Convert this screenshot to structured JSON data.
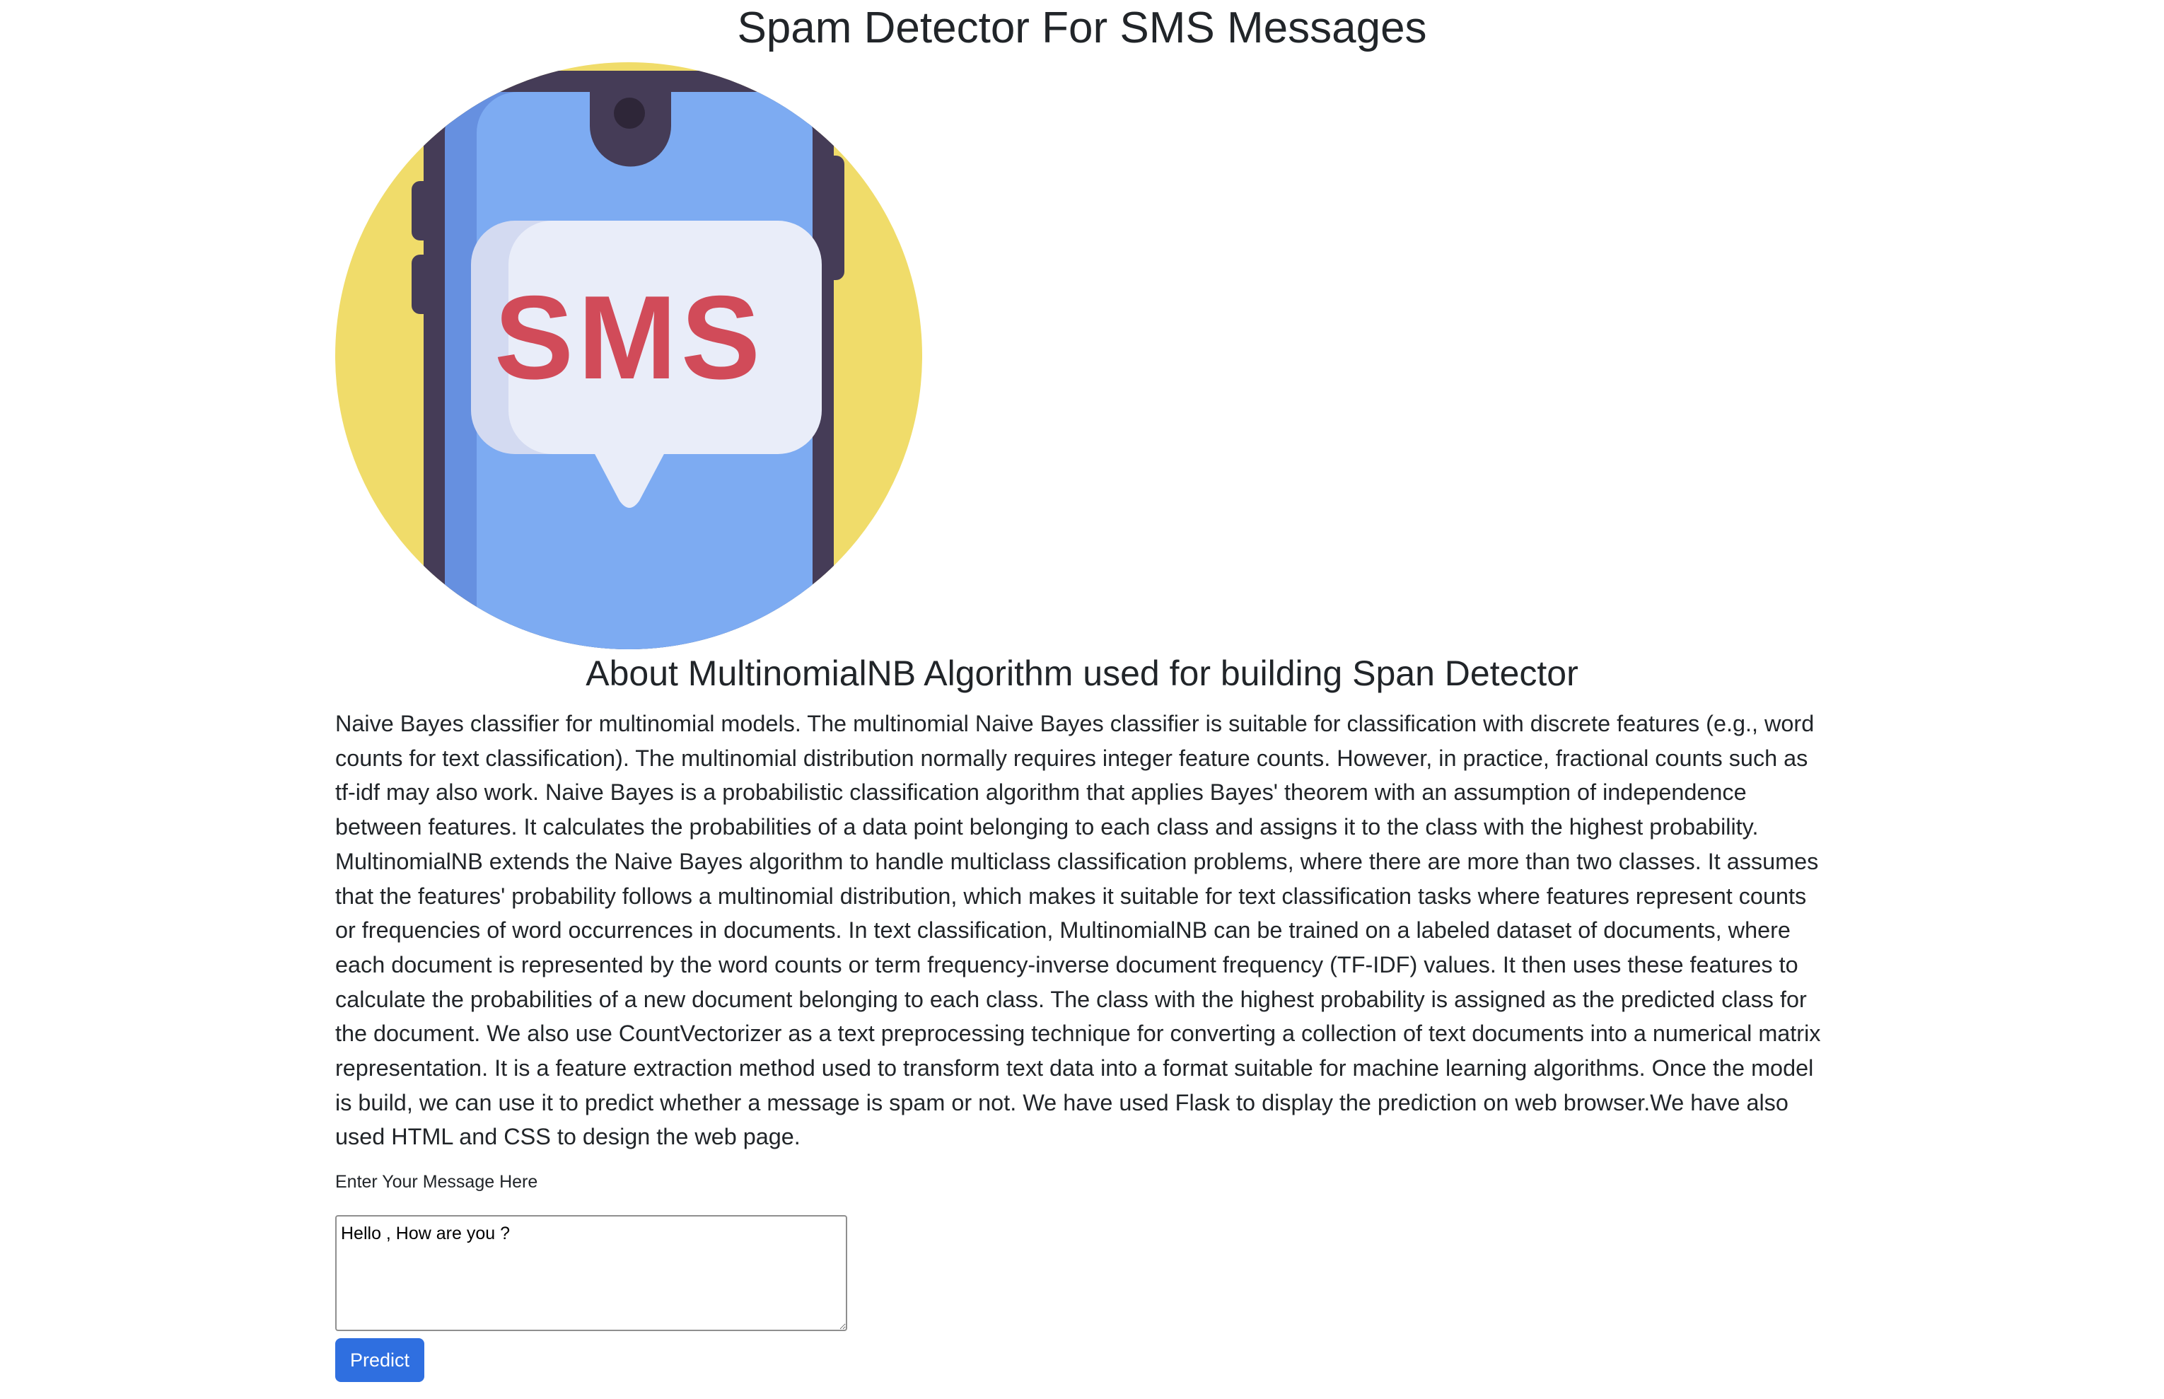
{
  "page": {
    "title": "Spam Detector For SMS Messages"
  },
  "hero": {
    "icon_name": "sms-phone-icon",
    "sms_text": "SMS",
    "colors": {
      "circle": "#f0dc6a",
      "phone_frame": "#453c57",
      "screen": "#7dabf2",
      "screen_shadow": "#6690e0",
      "bubble": "#e9edf9",
      "bubble_shadow": "#d3daf1",
      "sms_text": "#d14b59"
    }
  },
  "about": {
    "heading": "About MultinomialNB Algorithm used for building Span Detector",
    "text": "Naive Bayes classifier for multinomial models. The multinomial Naive Bayes classifier is suitable for classification with discrete features (e.g., word counts for text classification). The multinomial distribution normally requires integer feature counts. However, in practice, fractional counts such as tf-idf may also work. Naive Bayes is a probabilistic classification algorithm that applies Bayes' theorem with an assumption of independence between features. It calculates the probabilities of a data point belonging to each class and assigns it to the class with the highest probability. MultinomialNB extends the Naive Bayes algorithm to handle multiclass classification problems, where there are more than two classes. It assumes that the features' probability follows a multinomial distribution, which makes it suitable for text classification tasks where features represent counts or frequencies of word occurrences in documents. In text classification, MultinomialNB can be trained on a labeled dataset of documents, where each document is represented by the word counts or term frequency-inverse document frequency (TF-IDF) values. It then uses these features to calculate the probabilities of a new document belonging to each class. The class with the highest probability is assigned as the predicted class for the document. We also use CountVectorizer as a text preprocessing technique for converting a collection of text documents into a numerical matrix representation. It is a feature extraction method used to transform text data into a format suitable for machine learning algorithms. Once the model is build, we can use it to predict whether a message is spam or not. We have used Flask to display the prediction on web browser.We have also used HTML and CSS to design the web page."
  },
  "form": {
    "label": "Enter Your Message Here",
    "message_value": "Hello , How are you ?",
    "button_label": "Predict",
    "button_color": "#2f6fe0"
  }
}
